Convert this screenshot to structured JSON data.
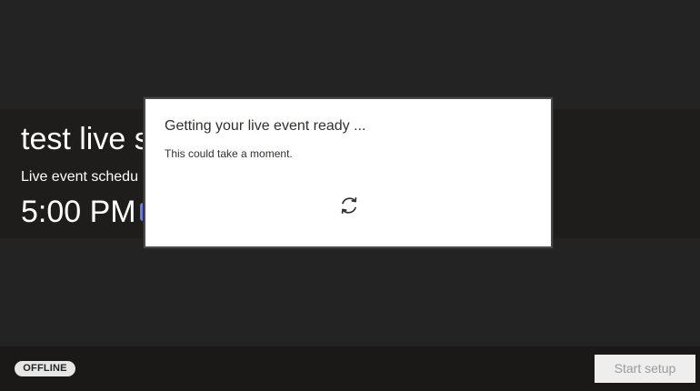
{
  "event": {
    "title": "test live s",
    "schedule_label": "Live event schedu",
    "schedule_time": "5:00 PM"
  },
  "dialog": {
    "title": "Getting your live event ready ...",
    "message": "This could take a moment.",
    "spinner_icon": "refresh-spinner-icon"
  },
  "footer": {
    "status": "OFFLINE",
    "start_setup_label": "Start setup"
  },
  "colors": {
    "background": "#232323",
    "hero_background": "#1f1d1c",
    "footer_background": "#1b1918",
    "accent": "#6f7bd0",
    "dialog_background": "#ffffff"
  }
}
